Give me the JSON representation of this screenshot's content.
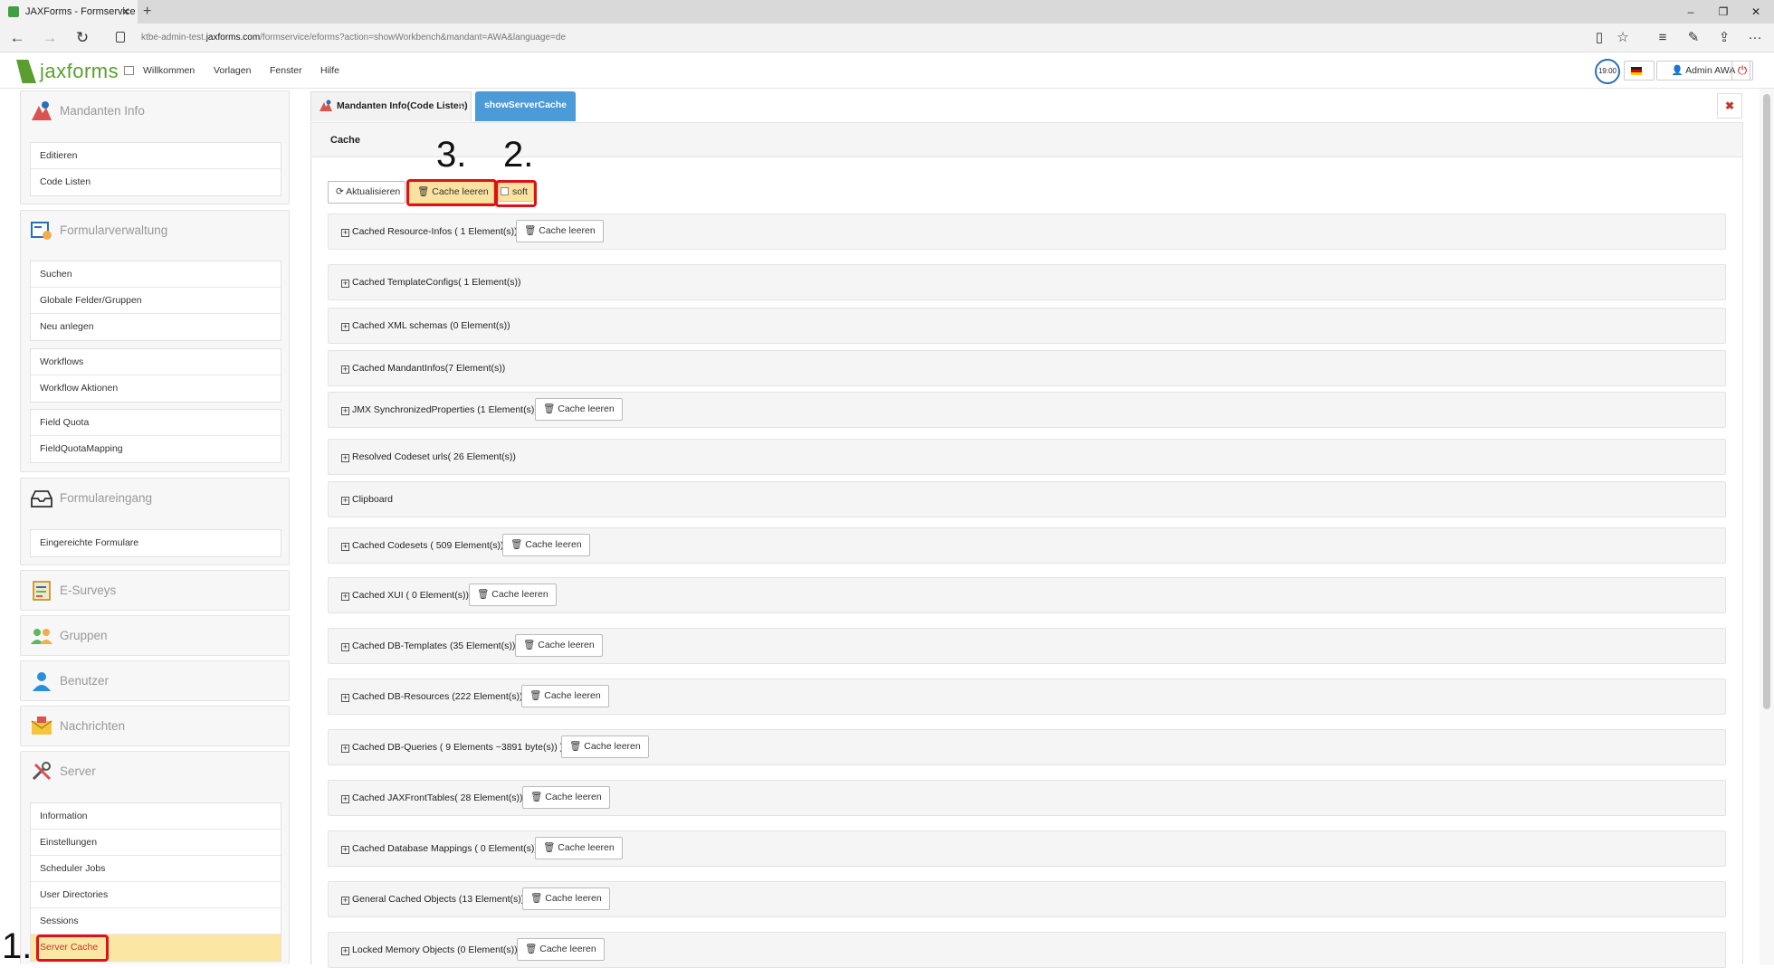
{
  "browser": {
    "tab_title": "JAXForms - Formservice",
    "url_prefix": "ktbe-admin-test.",
    "url_domain": "jaxforms.com",
    "url_path": "/formservice/eforms?action=showWorkbench&mandant=AWA&language=de"
  },
  "app": {
    "logo_text": "jaxforms",
    "menu": [
      "Willkommen",
      "Vorlagen",
      "Fenster",
      "Hilfe"
    ],
    "clock": "19:00",
    "user": "Admin AWA"
  },
  "sidebar": {
    "mandanten": {
      "title": "Mandanten Info",
      "items": [
        "Editieren",
        "Code Listen"
      ]
    },
    "formular": {
      "title": "Formularverwaltung",
      "items1": [
        "Suchen",
        "Globale Felder/Gruppen",
        "Neu anlegen"
      ],
      "items2": [
        "Workflows",
        "Workflow Aktionen"
      ],
      "items3": [
        "Field Quota",
        "FieldQuotaMapping"
      ]
    },
    "eingang": {
      "title": "Formulareingang",
      "items": [
        "Eingereichte Formulare"
      ]
    },
    "esurveys": "E-Surveys",
    "gruppen": "Gruppen",
    "benutzer": "Benutzer",
    "nachrichten": "Nachrichten",
    "server": {
      "title": "Server",
      "items": [
        "Information",
        "Einstellungen",
        "Scheduler Jobs",
        "User Directories",
        "Sessions",
        "Server Cache"
      ]
    }
  },
  "main": {
    "tabs": [
      "Mandanten Info(Code Listen)",
      "showServerCache"
    ],
    "card_title": "Cache",
    "refresh": "Aktualisieren",
    "clear": "Cache leeren",
    "soft": "soft",
    "steps": [
      "1.",
      "2.",
      "3."
    ],
    "rows": [
      "Cached Resource-Infos ( 1 Element(s))",
      "Cached TemplateConfigs( 1 Element(s))",
      "Cached XML schemas (0 Element(s))",
      "Cached MandantInfos(7 Element(s))",
      "JMX SynchronizedProperties (1 Element(s))",
      "Resolved Codeset urls( 26 Element(s))",
      "Clipboard",
      "Cached Codesets ( 509 Element(s))",
      "Cached XUI ( 0 Element(s))",
      "Cached DB-Templates (35 Element(s))",
      "Cached DB-Resources (222 Element(s))",
      "Cached DB-Queries ( 9 Elements ~3891 byte(s)) )",
      "Cached JAXFrontTables( 28 Element(s))",
      "Cached Database Mappings ( 0 Element(s))",
      "General Cached Objects (13 Element(s))",
      "Locked Memory Objects (0 Element(s))"
    ]
  }
}
